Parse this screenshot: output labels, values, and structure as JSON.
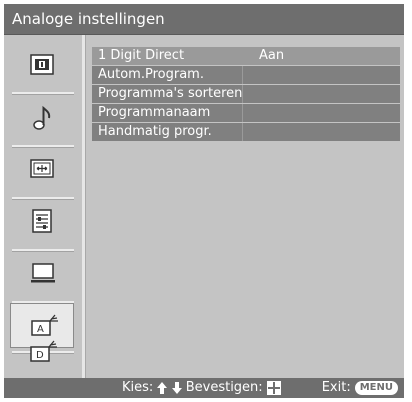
{
  "header": {
    "title": "Analoge instellingen"
  },
  "sidebar": {
    "items": [
      {
        "name": "picture-icon"
      },
      {
        "name": "sound-note-icon"
      },
      {
        "name": "screen-icon"
      },
      {
        "name": "setup-list-icon"
      },
      {
        "name": "pc-monitor-icon"
      },
      {
        "name": "analog-antenna-icon",
        "selected": true
      },
      {
        "name": "digital-antenna-icon"
      }
    ]
  },
  "settings": {
    "rows": [
      {
        "label": "1 Digit Direct",
        "value": "Aan"
      },
      {
        "label": "Autom.Program.",
        "value": ""
      },
      {
        "label": "Programma's sorteren",
        "value": ""
      },
      {
        "label": "Programmanaam",
        "value": ""
      },
      {
        "label": "Handmatig progr.",
        "value": ""
      }
    ]
  },
  "footer": {
    "select_label": "Kies:",
    "confirm_label": "Bevestigen:",
    "exit_label": "Exit:",
    "menu_button": "MENU"
  },
  "colors": {
    "bar": "#6e6e6e",
    "panel": "#c4c4c4",
    "row": "#808080",
    "row_highlight": "#9a9a9a"
  }
}
